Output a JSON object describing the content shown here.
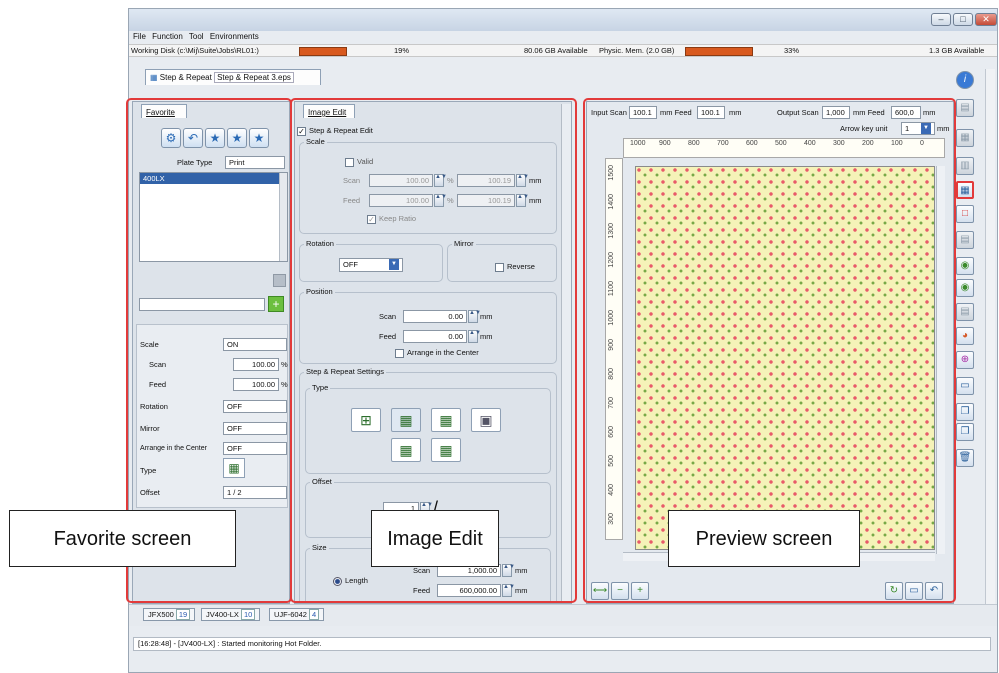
{
  "menu": [
    "File",
    "Function",
    "Tool",
    "Environments"
  ],
  "status": {
    "working_disk": "Working Disk (c:\\Mij\\Suite\\Jobs\\RL01:)",
    "disk_percent": "19%",
    "disk_available": "80.06 GB Available",
    "physic_mem": "Physic. Mem. (2.0 GB)",
    "mem_percent": "33%",
    "mem_available": "1.3 GB Available"
  },
  "job_tab": {
    "label": "Step & Repeat",
    "file": "Step & Repeat 3.eps"
  },
  "favorite": {
    "tab": "Favorite",
    "plate_type_label": "Plate Type",
    "plate_type_value": "Print",
    "list_item": "400LX",
    "props": [
      {
        "label": "Scale",
        "value": "ON"
      },
      {
        "label": "Scan",
        "value": "100.00",
        "unit": "%"
      },
      {
        "label": "Feed",
        "value": "100.00",
        "unit": "%"
      },
      {
        "label": "Rotation",
        "value": "OFF"
      },
      {
        "label": "Mirror",
        "value": "OFF"
      },
      {
        "label": "Arrange in the Center",
        "value": "OFF"
      },
      {
        "label": "Type",
        "value": ""
      },
      {
        "label": "Offset",
        "value": "1 / 2"
      }
    ]
  },
  "image_edit": {
    "tab": "Image Edit",
    "step_repeat_edit": "Step & Repeat Edit",
    "scale": {
      "title": "Scale",
      "valid": "Valid",
      "scan_label": "Scan",
      "feed_label": "Feed",
      "scan_pct": "100.00",
      "scan_val": "100.19",
      "feed_pct": "100.00",
      "feed_val": "100.19",
      "pct": "%",
      "mm": "mm",
      "keep_ratio": "Keep Ratio"
    },
    "rotation": {
      "title": "Rotation",
      "value": "OFF"
    },
    "mirror": {
      "title": "Mirror",
      "reverse": "Reverse"
    },
    "position": {
      "title": "Position",
      "scan_label": "Scan",
      "scan_value": "0.00",
      "feed_label": "Feed",
      "feed_value": "0.00",
      "mm": "mm",
      "center": "Arrange in the Center"
    },
    "settings_title": "Step & Repeat Settings",
    "type_title": "Type",
    "offset_title": "Offset",
    "offset_value": "1",
    "size": {
      "title": "Size",
      "length": "Length",
      "scan_label": "Scan",
      "scan_value": "1,000.00",
      "feed_label": "Feed",
      "feed_value": "600,000.00",
      "mm": "mm"
    }
  },
  "preview": {
    "input_scan_label": "Input Scan",
    "input_scan": "100.1",
    "input_feed_label": "mm Feed",
    "input_feed": "100.1",
    "mm": "mm",
    "output_scan_label": "Output Scan",
    "output_scan": "1,000",
    "output_feed_label": "mm Feed",
    "output_feed": "600,0",
    "arrow_key_label": "Arrow key unit",
    "arrow_key_value": "1",
    "h_ticks": [
      "1000",
      "900",
      "800",
      "700",
      "600",
      "500",
      "400",
      "300",
      "200",
      "100",
      "0"
    ],
    "v_ticks": [
      "1500",
      "1400",
      "1300",
      "1200",
      "1100",
      "1000",
      "900",
      "800",
      "700",
      "600",
      "500",
      "400",
      "300"
    ]
  },
  "printers": [
    {
      "name": "JFX500",
      "count": "19"
    },
    {
      "name": "JV400-LX",
      "count": "10"
    },
    {
      "name": "UJF-6042",
      "count": "4"
    }
  ],
  "log": "[16:28:48] - [JV400-LX] : Started monitoring Hot Folder.",
  "callouts": {
    "favorite": "Favorite screen",
    "image_edit": "Image Edit",
    "preview": "Preview screen"
  }
}
